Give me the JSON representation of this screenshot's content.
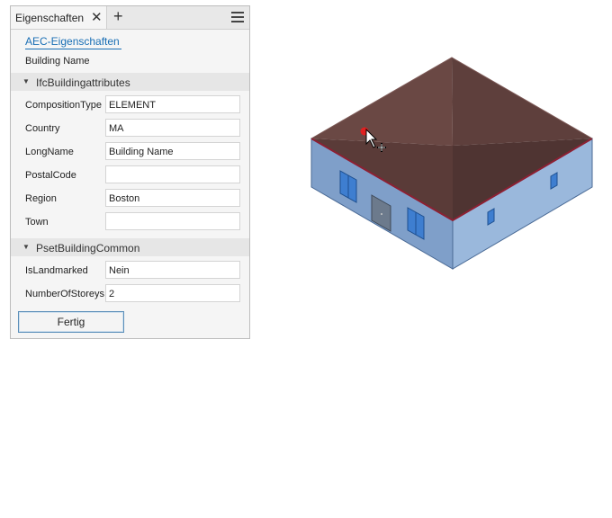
{
  "panel": {
    "tab_title": "Eigenschaften",
    "tab_close_icon": "close-icon",
    "tab_add_icon": "plus-icon",
    "menu_icon": "hamburger-menu-icon",
    "aec_link": "AEC-Eigenschaften",
    "building_name_label": "Building Name",
    "sections": [
      {
        "title": "IfcBuildingattributes",
        "rows": [
          {
            "label": "CompositionType",
            "value": "ELEMENT"
          },
          {
            "label": "Country",
            "value": "MA"
          },
          {
            "label": "LongName",
            "value": "Building Name"
          },
          {
            "label": "PostalCode",
            "value": ""
          },
          {
            "label": "Region",
            "value": "Boston"
          },
          {
            "label": "Town",
            "value": ""
          }
        ]
      },
      {
        "title": "PsetBuildingCommon",
        "rows": [
          {
            "label": "IsLandmarked",
            "value": "Nein"
          },
          {
            "label": "NumberOfStoreys",
            "value": "2"
          }
        ]
      }
    ],
    "done_button": "Fertig"
  },
  "viewport": {
    "roof_color": "#5a3b38",
    "wall_color": "#8fb0d6",
    "cursor_icon": "arrow-cursor-icon"
  }
}
